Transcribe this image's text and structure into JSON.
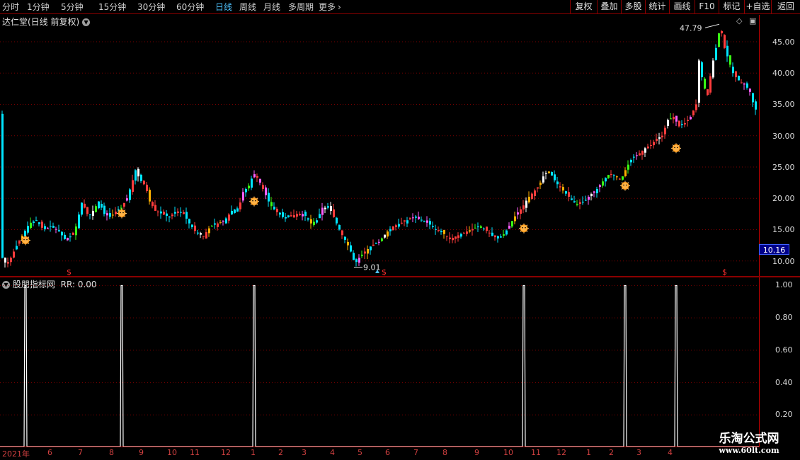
{
  "toolbar": {
    "timeframes": [
      "分时",
      "1分钟",
      "5分钟",
      "15分钟",
      "30分钟",
      "60分钟",
      "日线",
      "周线",
      "月线",
      "多周期",
      "更多"
    ],
    "active_index": 6,
    "buttons": [
      "复权",
      "叠加",
      "多股",
      "统计",
      "画线",
      "F10",
      "标记",
      "+自选",
      "返回"
    ]
  },
  "main": {
    "title": "达仁堂(日线 前复权)",
    "last_price": "10.16",
    "high_label": "47.79",
    "low_label": "9.01",
    "signal_mark": "$"
  },
  "indicator": {
    "title": "股朋指标网",
    "rr_label": "RR: 0.00"
  },
  "watermark": {
    "title": "乐淘公式网",
    "url": "www.60lt.com"
  },
  "chart_data": [
    {
      "type": "candlestick",
      "title": "达仁堂(日线 前复权)",
      "y_ticks": [
        "10.00",
        "15.00",
        "20.00",
        "25.00",
        "30.00",
        "35.00",
        "40.00",
        "45.00"
      ],
      "ylim": [
        7.6,
        49.4
      ],
      "grid": true,
      "annotations": {
        "high": 47.79,
        "low": 9.01,
        "last": 10.16
      },
      "x_ticks": [
        "2021年",
        "6",
        "7",
        "8",
        "9",
        "10",
        "11",
        "12",
        "1",
        "2",
        "3",
        "4",
        "5",
        "6",
        "7",
        "8",
        "9",
        "10",
        "11",
        "12",
        "1",
        "2",
        "3",
        "4"
      ],
      "close_path": [
        [
          0,
          11.0
        ],
        [
          4,
          10.0
        ],
        [
          8,
          9.5
        ],
        [
          14,
          10.5
        ],
        [
          20,
          12.0
        ],
        [
          30,
          14.0
        ],
        [
          40,
          16.0
        ],
        [
          50,
          16.5
        ],
        [
          60,
          15.0
        ],
        [
          70,
          15.5
        ],
        [
          80,
          15.0
        ],
        [
          90,
          13.5
        ],
        [
          100,
          14.0
        ],
        [
          108,
          16.0
        ],
        [
          113,
          19.5
        ],
        [
          118,
          18.5
        ],
        [
          124,
          17.0
        ],
        [
          130,
          18.0
        ],
        [
          138,
          19.5
        ],
        [
          146,
          17.5
        ],
        [
          155,
          17.0
        ],
        [
          163,
          18.0
        ],
        [
          170,
          18.5
        ],
        [
          178,
          20.0
        ],
        [
          185,
          22.5
        ],
        [
          190,
          24.5
        ],
        [
          196,
          23.0
        ],
        [
          204,
          22.0
        ],
        [
          210,
          19.5
        ],
        [
          218,
          18.0
        ],
        [
          228,
          17.5
        ],
        [
          238,
          17.0
        ],
        [
          248,
          18.0
        ],
        [
          258,
          17.5
        ],
        [
          266,
          16.0
        ],
        [
          276,
          14.5
        ],
        [
          286,
          14.0
        ],
        [
          296,
          15.5
        ],
        [
          306,
          16.0
        ],
        [
          316,
          16.5
        ],
        [
          326,
          18.0
        ],
        [
          336,
          18.5
        ],
        [
          342,
          21.0
        ],
        [
          350,
          22.0
        ],
        [
          357,
          24.0
        ],
        [
          364,
          23.0
        ],
        [
          372,
          21.0
        ],
        [
          380,
          19.0
        ],
        [
          388,
          18.0
        ],
        [
          398,
          17.0
        ],
        [
          408,
          17.0
        ],
        [
          418,
          17.5
        ],
        [
          428,
          17.5
        ],
        [
          438,
          16.0
        ],
        [
          446,
          16.5
        ],
        [
          454,
          18.5
        ],
        [
          464,
          18.5
        ],
        [
          472,
          16.5
        ],
        [
          480,
          14.5
        ],
        [
          488,
          13.0
        ],
        [
          494,
          11.5
        ],
        [
          500,
          9.5
        ],
        [
          506,
          10.5
        ],
        [
          514,
          11.5
        ],
        [
          524,
          12.5
        ],
        [
          534,
          13.0
        ],
        [
          544,
          14.5
        ],
        [
          554,
          15.5
        ],
        [
          564,
          16.0
        ],
        [
          574,
          16.5
        ],
        [
          584,
          17.0
        ],
        [
          594,
          16.5
        ],
        [
          604,
          16.0
        ],
        [
          614,
          15.0
        ],
        [
          624,
          14.5
        ],
        [
          634,
          13.5
        ],
        [
          644,
          14.0
        ],
        [
          654,
          14.5
        ],
        [
          664,
          15.0
        ],
        [
          674,
          15.5
        ],
        [
          684,
          15.0
        ],
        [
          694,
          14.0
        ],
        [
          704,
          13.5
        ],
        [
          712,
          14.5
        ],
        [
          720,
          16.0
        ],
        [
          728,
          17.5
        ],
        [
          736,
          18.5
        ],
        [
          744,
          20.0
        ],
        [
          752,
          21.0
        ],
        [
          760,
          22.0
        ],
        [
          768,
          24.0
        ],
        [
          776,
          24.0
        ],
        [
          784,
          22.5
        ],
        [
          792,
          21.5
        ],
        [
          800,
          20.5
        ],
        [
          808,
          19.5
        ],
        [
          816,
          19.0
        ],
        [
          824,
          19.5
        ],
        [
          832,
          20.5
        ],
        [
          842,
          21.5
        ],
        [
          852,
          23.0
        ],
        [
          860,
          24.0
        ],
        [
          868,
          23.5
        ],
        [
          876,
          23.0
        ],
        [
          884,
          25.0
        ],
        [
          892,
          26.5
        ],
        [
          900,
          27.0
        ],
        [
          910,
          28.0
        ],
        [
          918,
          28.5
        ],
        [
          926,
          29.5
        ],
        [
          934,
          30.0
        ],
        [
          942,
          32.5
        ],
        [
          950,
          33.0
        ],
        [
          958,
          31.5
        ],
        [
          966,
          32.0
        ],
        [
          974,
          33.0
        ],
        [
          982,
          35.0
        ],
        [
          986,
          42.0
        ],
        [
          992,
          38.0
        ],
        [
          998,
          36.5
        ],
        [
          1004,
          41.0
        ],
        [
          1010,
          44.0
        ],
        [
          1016,
          47.5
        ],
        [
          1022,
          44.0
        ],
        [
          1028,
          42.0
        ],
        [
          1034,
          40.0
        ],
        [
          1040,
          39.0
        ],
        [
          1046,
          38.5
        ],
        [
          1052,
          38.0
        ],
        [
          1058,
          37.0
        ],
        [
          1064,
          34.5
        ],
        [
          1070,
          33.5
        ]
      ],
      "signal_markers": [
        {
          "type": "sun",
          "x_index": 36,
          "price": 13.3
        },
        {
          "type": "sun",
          "x_index": 172,
          "price": 17.6
        },
        {
          "type": "sun",
          "x_index": 359,
          "price": 19.5
        },
        {
          "type": "sun",
          "x_index": 740,
          "price": 15.2
        },
        {
          "type": "sun",
          "x_index": 883,
          "price": 22.0
        },
        {
          "type": "sun",
          "x_index": 955,
          "price": 28.0
        }
      ],
      "dollar_markers": [
        98,
        543,
        1024
      ],
      "arrow_marker": 533
    },
    {
      "type": "line",
      "title": "股朋指标网",
      "y_ticks": [
        "0.20",
        "0.40",
        "0.60",
        "0.80",
        "1.00"
      ],
      "ylim": [
        0.0,
        1.05
      ],
      "spikes": [
        36,
        172,
        359,
        740,
        883,
        955
      ],
      "spike_value": 1.0
    }
  ]
}
